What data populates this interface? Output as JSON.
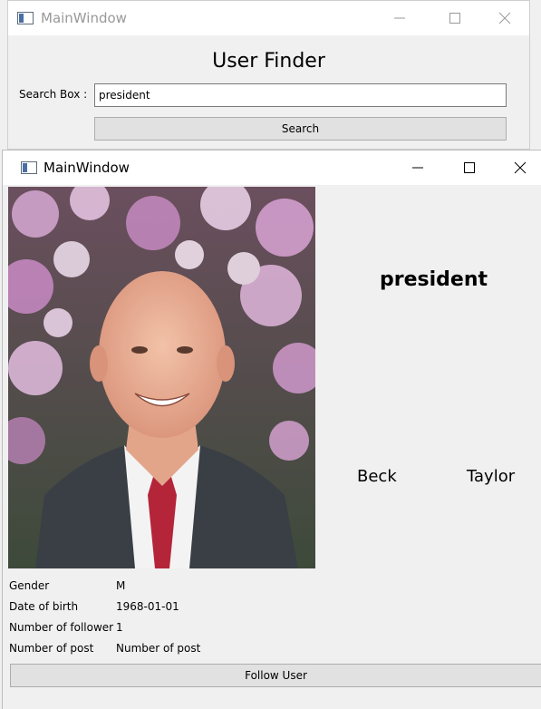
{
  "back_window": {
    "title": "MainWindow",
    "heading": "User Finder",
    "search_label": "Search Box :",
    "search_value": "president",
    "search_button": "Search"
  },
  "front_window": {
    "title": "MainWindow",
    "username": "president",
    "first_name": "Beck",
    "last_name": "Taylor",
    "details": [
      {
        "label": "Gender",
        "value": "M"
      },
      {
        "label": "Date of birth",
        "value": "1968-01-01"
      },
      {
        "label": "Number of follower",
        "value": "1"
      },
      {
        "label": "Number of post",
        "value": "Number of post"
      }
    ],
    "follow_button": "Follow User"
  },
  "icons": {
    "app": "window-app-icon",
    "minimize": "minimize-icon",
    "maximize": "maximize-icon",
    "close": "close-icon"
  }
}
